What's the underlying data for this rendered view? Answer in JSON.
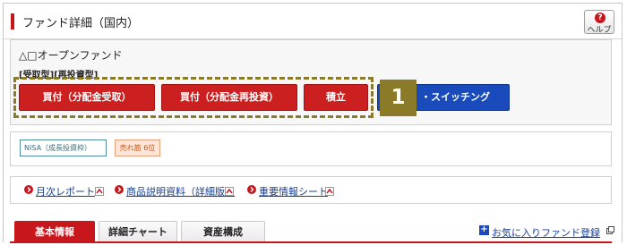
{
  "header": {
    "title": "ファンド詳細（国内）",
    "help_label": "ヘルプ",
    "help_icon": "question-icon"
  },
  "fund": {
    "name": "△□オープンファンド",
    "type": "[受取型][再投資型]"
  },
  "actions": {
    "buy_receive": "買付（分配金受取）",
    "buy_reinvest": "買付（分配金再投資）",
    "accumulate": "積立",
    "switching": "・スイッチング",
    "step_badge": "1"
  },
  "tags": {
    "nisa": "NISA（成長投資枠）",
    "rank": "売れ筋 6位"
  },
  "documents": [
    {
      "label": "月次レポート"
    },
    {
      "label": "商品説明資料（詳細版）"
    },
    {
      "label": "重要情報シート"
    }
  ],
  "tabs": [
    {
      "label": "基本情報"
    },
    {
      "label": "詳細チャート"
    },
    {
      "label": "資産構成"
    }
  ],
  "favorite": {
    "label": "お気に入りファンド登録"
  },
  "colors": {
    "brand_red": "#c8161d",
    "button_red": "#cc1f1f",
    "switch_blue": "#1a4bbd",
    "highlight_olive": "#8b7a28",
    "link_blue": "#1a3f8f"
  }
}
